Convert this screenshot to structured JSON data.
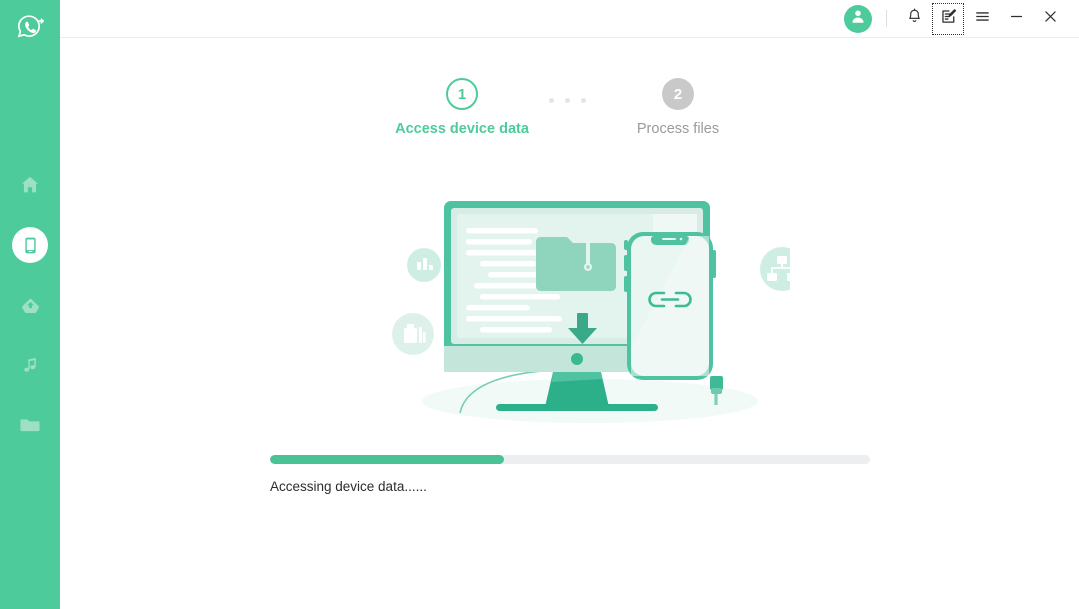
{
  "app": {
    "name": "WhatsApp Transfer",
    "logo_icon": "whatsapp-transfer-logo-icon",
    "accent_color": "#4ecb9b",
    "sidebar_color": "#4ecb9b"
  },
  "sidebar": {
    "items": [
      {
        "id": "home",
        "icon": "home-icon",
        "label": "Home",
        "active": false
      },
      {
        "id": "device",
        "icon": "phone-icon",
        "label": "Device",
        "active": true
      },
      {
        "id": "backup",
        "icon": "cloud-icon",
        "label": "Backup",
        "active": false
      },
      {
        "id": "music",
        "icon": "music-note-icon",
        "label": "Music",
        "active": false
      },
      {
        "id": "files",
        "icon": "folder-icon",
        "label": "Files",
        "active": false
      }
    ]
  },
  "titlebar": {
    "avatar": {
      "icon": "user-avatar-icon",
      "label": "Account"
    },
    "buttons": [
      {
        "id": "notifications",
        "icon": "bell-icon",
        "label": "Notifications",
        "focused": false
      },
      {
        "id": "feedback",
        "icon": "feedback-icon",
        "label": "Feedback",
        "focused": true
      },
      {
        "id": "menu",
        "icon": "hamburger-menu-icon",
        "label": "Menu",
        "focused": false
      },
      {
        "id": "minimize",
        "icon": "minimize-icon",
        "label": "Minimize",
        "focused": false
      },
      {
        "id": "close",
        "icon": "close-icon",
        "label": "Close",
        "focused": false
      }
    ]
  },
  "steps": {
    "dots_count": 3,
    "items": [
      {
        "number": "1",
        "label": "Access device data",
        "state": "active"
      },
      {
        "number": "2",
        "label": "Process files",
        "state": "inactive"
      }
    ]
  },
  "illustration": {
    "name": "device-data-transfer-illustration",
    "badges": [
      {
        "id": "chart-badge",
        "icon": "bar-chart-icon"
      },
      {
        "id": "docs-badge",
        "icon": "document-stack-icon"
      },
      {
        "id": "sitemap-badge",
        "icon": "sitemap-icon"
      }
    ],
    "monitor_icon": "desktop-monitor-icon",
    "folder_icon": "zipped-folder-icon",
    "download_icon": "download-arrow-icon",
    "phone_icon": "smartphone-icon",
    "link_icon": "chain-link-icon"
  },
  "progress": {
    "percent": 39,
    "status_text": "Accessing device data......",
    "fill_color": "#4ac295",
    "track_color": "#eceef0"
  }
}
